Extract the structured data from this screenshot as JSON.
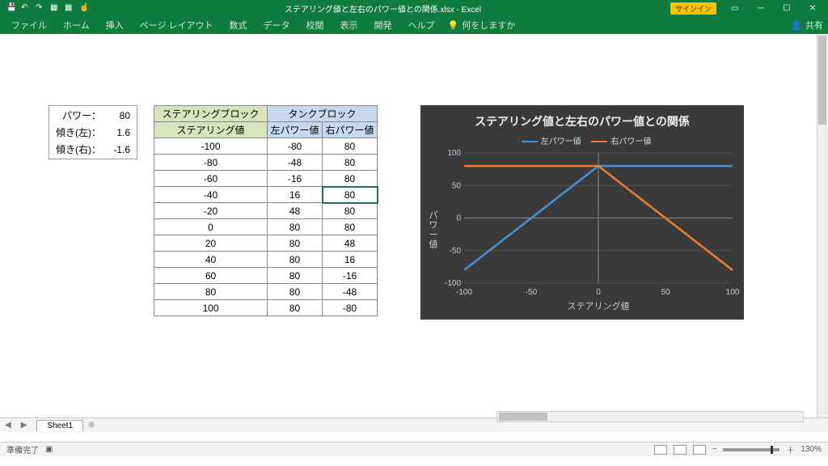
{
  "app": {
    "filename": "ステアリング値と左右のパワー値との関係.xlsx",
    "appname": "Excel",
    "signin": "サインイン",
    "share_label": "共有"
  },
  "ribbon": {
    "file": "ファイル",
    "home": "ホーム",
    "insert": "挿入",
    "pagelayout": "ページ レイアウト",
    "formulas": "数式",
    "data": "データ",
    "review": "校閲",
    "view": "表示",
    "developer": "開発",
    "help": "ヘルプ",
    "tellme": "何をしますか"
  },
  "params": {
    "power_label": "パワー：",
    "power_value": "80",
    "slope_l_label": "傾き(左)：",
    "slope_l_value": "1.6",
    "slope_r_label": "傾き(右)：",
    "slope_r_value": "-1.6"
  },
  "table": {
    "steer_block": "ステアリングブロック",
    "tank_block": "タンクブロック",
    "steer_val": "ステアリング値",
    "left_power": "左パワー値",
    "right_power": "右パワー値",
    "rows": [
      {
        "s": "-100",
        "l": "-80",
        "r": "80"
      },
      {
        "s": "-80",
        "l": "-48",
        "r": "80"
      },
      {
        "s": "-60",
        "l": "-16",
        "r": "80"
      },
      {
        "s": "-40",
        "l": "16",
        "r": "80"
      },
      {
        "s": "-20",
        "l": "48",
        "r": "80"
      },
      {
        "s": "0",
        "l": "80",
        "r": "80"
      },
      {
        "s": "20",
        "l": "80",
        "r": "48"
      },
      {
        "s": "40",
        "l": "80",
        "r": "16"
      },
      {
        "s": "60",
        "l": "80",
        "r": "-16"
      },
      {
        "s": "80",
        "l": "80",
        "r": "-48"
      },
      {
        "s": "100",
        "l": "80",
        "r": "-80"
      }
    ]
  },
  "chart_data": {
    "type": "line",
    "title": "ステアリング値と左右のパワー値との関係",
    "xlabel": "ステアリング値",
    "ylabel": "パワー値",
    "x": [
      -100,
      -80,
      -60,
      -40,
      -20,
      0,
      20,
      40,
      60,
      80,
      100
    ],
    "series": [
      {
        "name": "左パワー値",
        "color": "#4a90d9",
        "values": [
          -80,
          -48,
          -16,
          16,
          48,
          80,
          80,
          80,
          80,
          80,
          80
        ]
      },
      {
        "name": "右パワー値",
        "color": "#ed7d31",
        "values": [
          80,
          80,
          80,
          80,
          80,
          80,
          48,
          16,
          -16,
          -48,
          -80
        ]
      }
    ],
    "xlim": [
      -100,
      100
    ],
    "ylim": [
      -100,
      100
    ],
    "xticks": [
      -100,
      -50,
      0,
      50,
      100
    ],
    "yticks": [
      -100,
      -50,
      0,
      50,
      100
    ]
  },
  "tabs": {
    "sheet1": "Sheet1"
  },
  "status": {
    "ready": "準備完了",
    "zoom": "130%"
  }
}
